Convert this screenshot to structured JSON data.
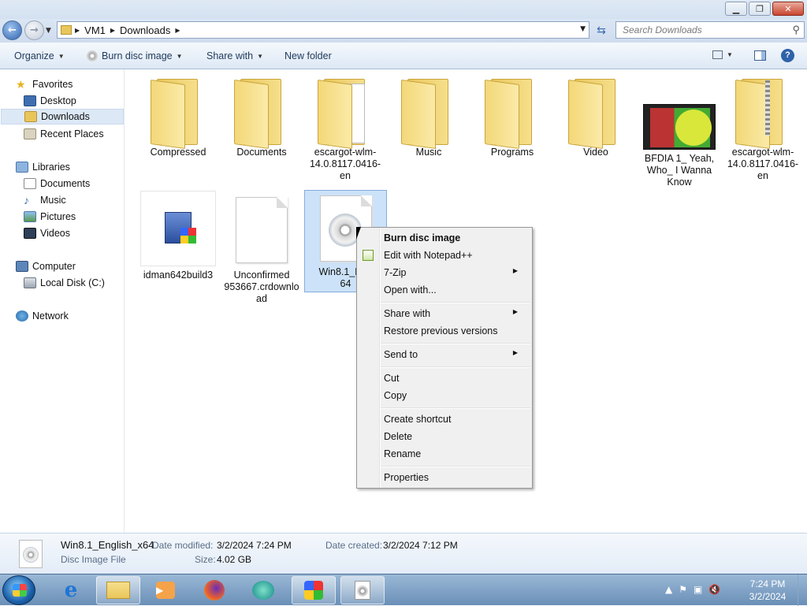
{
  "address": {
    "crumbs": [
      "VM1",
      "Downloads"
    ],
    "search_placeholder": "Search Downloads"
  },
  "toolbar": {
    "organize": "Organize",
    "burn": "Burn disc image",
    "share": "Share with",
    "new_folder": "New folder"
  },
  "sidebar": {
    "favorites": "Favorites",
    "desktop": "Desktop",
    "downloads": "Downloads",
    "recent": "Recent Places",
    "libraries": "Libraries",
    "documents": "Documents",
    "music": "Music",
    "pictures": "Pictures",
    "videos": "Videos",
    "computer": "Computer",
    "local_disk": "Local Disk (C:)",
    "network": "Network"
  },
  "files": {
    "compressed": "Compressed",
    "documents": "Documents",
    "escargot1": "escargot-wlm-14.0.8117.0416-en",
    "music": "Music",
    "programs": "Programs",
    "video": "Video",
    "bfdia": "BFDIA 1_ Yeah, Who_ I Wanna Know",
    "escargot2": "escargot-wlm-14.0.8117.0416-en",
    "idman": "idman642build3",
    "unconfirmed": "Unconfirmed 953667.crdownload",
    "win81": "Win8.1_English_x64"
  },
  "win81_visible_label": "Win8.1_Eng\n64",
  "context_menu": {
    "burn": "Burn disc image",
    "notepad": "Edit with Notepad++",
    "sevenzip": "7-Zip",
    "openwith": "Open with...",
    "sharewith": "Share with",
    "restore": "Restore previous versions",
    "sendto": "Send to",
    "cut": "Cut",
    "copy": "Copy",
    "shortcut": "Create shortcut",
    "delete": "Delete",
    "rename": "Rename",
    "properties": "Properties"
  },
  "details": {
    "name": "Win8.1_English_x64",
    "modified_label": "Date modified:",
    "modified": "3/2/2024 7:24 PM",
    "created_label": "Date created:",
    "created": "3/2/2024 7:12 PM",
    "type": "Disc Image File",
    "size_label": "Size:",
    "size": "4.02 GB"
  },
  "clock": {
    "time": "7:24 PM",
    "date": "3/2/2024"
  }
}
